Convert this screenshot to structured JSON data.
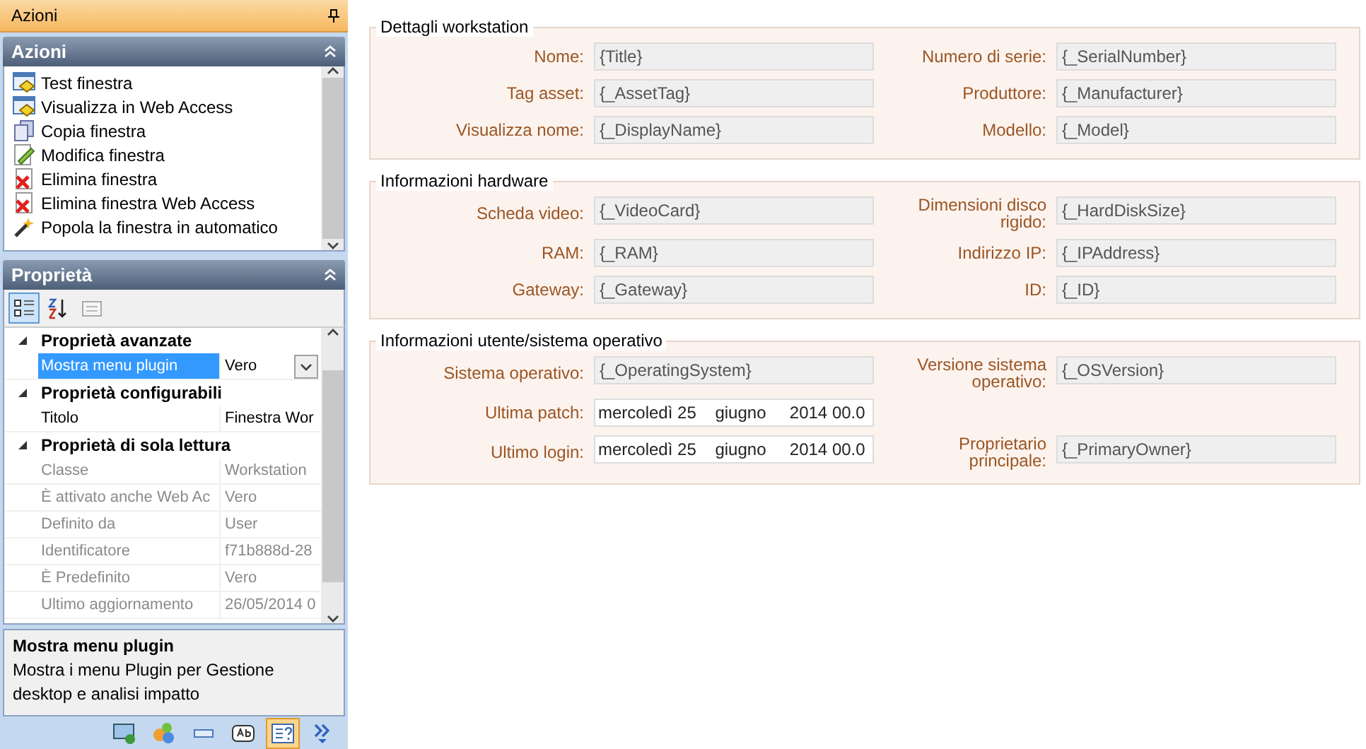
{
  "pane_title": "Azioni",
  "actions_panel": {
    "title": "Azioni",
    "items": [
      {
        "label": "Test finestra",
        "kind": "window"
      },
      {
        "label": "Visualizza in Web Access",
        "kind": "window"
      },
      {
        "label": "Copia finestra",
        "kind": "copy"
      },
      {
        "label": "Modifica finestra",
        "kind": "edit"
      },
      {
        "label": "Elimina finestra",
        "kind": "delete"
      },
      {
        "label": "Elimina finestra Web Access",
        "kind": "delete"
      },
      {
        "label": "Popola la finestra in automatico",
        "kind": "wand"
      }
    ]
  },
  "properties_panel": {
    "title": "Proprietà",
    "tools": [
      {
        "kind": "categorized",
        "selected": true
      },
      {
        "kind": "alphabetical",
        "selected": false
      },
      {
        "kind": "pages",
        "selected": false
      }
    ],
    "categories": [
      {
        "label": "Proprietà avanzate",
        "expanded": true,
        "rows": [
          {
            "name": "Mostra menu plugin",
            "value": "Vero",
            "selected": true,
            "disabled": false,
            "dropdown": true
          }
        ]
      },
      {
        "label": "Proprietà configurabili",
        "expanded": true,
        "rows": [
          {
            "name": "Titolo",
            "value": "Finestra Wor",
            "selected": false,
            "disabled": false,
            "dropdown": false
          }
        ]
      },
      {
        "label": "Proprietà di sola lettura",
        "expanded": true,
        "rows": [
          {
            "name": "Classe",
            "value": "Workstation",
            "selected": false,
            "disabled": true,
            "dropdown": false
          },
          {
            "name": "È attivato anche Web Ac",
            "value": "Vero",
            "selected": false,
            "disabled": true,
            "dropdown": false
          },
          {
            "name": "Definito da",
            "value": "User",
            "selected": false,
            "disabled": true,
            "dropdown": false
          },
          {
            "name": "Identificatore",
            "value": "f71b888d-28",
            "selected": false,
            "disabled": true,
            "dropdown": false
          },
          {
            "name": "È Predefinito",
            "value": "Vero",
            "selected": false,
            "disabled": true,
            "dropdown": false
          },
          {
            "name": "Ultimo aggiornamento",
            "value": "26/05/2014 0",
            "selected": false,
            "disabled": true,
            "dropdown": false
          }
        ]
      }
    ],
    "description": {
      "title": "Mostra menu plugin",
      "text": "Mostra i menu Plugin per Gestione desktop e analisi impatto"
    }
  },
  "bottom_tools": [
    {
      "kind": "monitor",
      "selected": false
    },
    {
      "kind": "shapes",
      "selected": false
    },
    {
      "kind": "field",
      "selected": false
    },
    {
      "kind": "textbox",
      "selected": false
    },
    {
      "kind": "help",
      "selected": true
    },
    {
      "kind": "more",
      "selected": false
    }
  ],
  "sections": [
    {
      "title": "Dettagli workstation",
      "rows": [
        {
          "left": {
            "label": "Nome:",
            "value": "{Title}",
            "kind": "text"
          },
          "right": {
            "label": "Numero di serie:",
            "value": "{_SerialNumber}",
            "kind": "text"
          }
        },
        {
          "left": {
            "label": "Tag asset:",
            "value": "{_AssetTag}",
            "kind": "text"
          },
          "right": {
            "label": "Produttore:",
            "value": "{_Manufacturer}",
            "kind": "text"
          }
        },
        {
          "left": {
            "label": "Visualizza nome:",
            "value": "{_DisplayName}",
            "kind": "text"
          },
          "right": {
            "label": "Modello:",
            "value": "{_Model}",
            "kind": "text"
          }
        }
      ]
    },
    {
      "title": "Informazioni hardware",
      "rows": [
        {
          "left": {
            "label": "Scheda video:",
            "value": "{_VideoCard}",
            "kind": "text"
          },
          "right": {
            "label": "Dimensioni disco rigido:",
            "value": "{_HardDiskSize}",
            "kind": "text"
          }
        },
        {
          "left": {
            "label": "RAM:",
            "value": "{_RAM}",
            "kind": "text"
          },
          "right": {
            "label": "Indirizzo IP:",
            "value": "{_IPAddress}",
            "kind": "text"
          }
        },
        {
          "left": {
            "label": "Gateway:",
            "value": "{_Gateway}",
            "kind": "text"
          },
          "right": {
            "label": "ID:",
            "value": "{_ID}",
            "kind": "text"
          }
        }
      ]
    },
    {
      "title": "Informazioni utente/sistema operativo",
      "rows": [
        {
          "left": {
            "label": "Sistema operativo:",
            "value": "{_OperatingSystem}",
            "kind": "text"
          },
          "right": {
            "label": "Versione sistema operativo:",
            "value": "{_OSVersion}",
            "kind": "text"
          }
        },
        {
          "left": {
            "label": "Ultima patch:",
            "value": "mercoledì 25    giugno     2014 00.0",
            "kind": "date"
          }
        },
        {
          "left": {
            "label": "Ultimo login:",
            "value": "mercoledì 25    giugno     2014 00.0",
            "kind": "date"
          },
          "right": {
            "label": "Proprietario principale:",
            "value": "{_PrimaryOwner}",
            "kind": "text"
          }
        }
      ]
    }
  ]
}
